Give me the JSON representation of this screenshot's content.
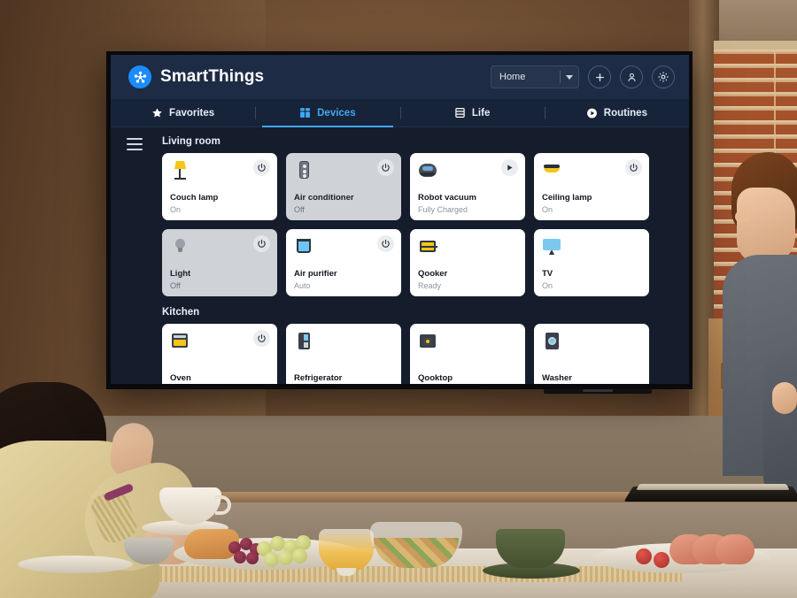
{
  "app": {
    "brand_name": "SmartThings",
    "logo_icon": "smartthings-logo-icon",
    "home_selector": {
      "value": "Home",
      "caret_icon": "chevron-down-icon"
    },
    "header_buttons": [
      {
        "name": "add-button",
        "icon": "plus-icon",
        "label": "+"
      },
      {
        "name": "account-button",
        "icon": "person-icon",
        "label": ""
      },
      {
        "name": "settings-button",
        "icon": "gear-icon",
        "label": ""
      }
    ],
    "menu_icon": "hamburger-menu-icon"
  },
  "tabs": [
    {
      "label": "Favorites",
      "icon": "star-icon",
      "active": false
    },
    {
      "label": "Devices",
      "icon": "grid-icon",
      "active": true
    },
    {
      "label": "Life",
      "icon": "book-icon",
      "active": false
    },
    {
      "label": "Routines",
      "icon": "play-circle-icon",
      "active": false
    }
  ],
  "rooms": [
    {
      "title": "Living room",
      "devices": [
        {
          "name": "Couch lamp",
          "status": "On",
          "icon": "floor-lamp-icon",
          "state": "on",
          "control": "power"
        },
        {
          "name": "Air conditioner",
          "status": "Off",
          "icon": "remote-control-icon",
          "state": "off",
          "control": "power"
        },
        {
          "name": "Robot vacuum",
          "status": "Fully Charged",
          "icon": "robot-vacuum-icon",
          "state": "on",
          "control": "play"
        },
        {
          "name": "Ceiling lamp",
          "status": "On",
          "icon": "ceiling-lamp-icon",
          "state": "on",
          "control": "power"
        },
        {
          "name": "Light",
          "status": "Off",
          "icon": "light-bulb-icon",
          "state": "off",
          "control": "power"
        },
        {
          "name": "Air purifier",
          "status": "Auto",
          "icon": "air-purifier-icon",
          "state": "on",
          "control": "power"
        },
        {
          "name": "Qooker",
          "status": "Ready",
          "icon": "qooker-tap-icon",
          "state": "on",
          "control": "none"
        },
        {
          "name": "TV",
          "status": "On",
          "icon": "television-icon",
          "state": "on",
          "control": "none"
        }
      ]
    },
    {
      "title": "Kitchen",
      "devices": [
        {
          "name": "Oven",
          "status": "",
          "icon": "oven-icon",
          "state": "on",
          "control": "power"
        },
        {
          "name": "Refrigerator",
          "status": "",
          "icon": "refrigerator-icon",
          "state": "on",
          "control": "none"
        },
        {
          "name": "Qooktop",
          "status": "",
          "icon": "cooktop-icon",
          "state": "on",
          "control": "none"
        },
        {
          "name": "Washer",
          "status": "",
          "icon": "washer-icon",
          "state": "on",
          "control": "none"
        }
      ]
    }
  ],
  "colors": {
    "brand_blue": "#1a8cff",
    "accent_blue": "#3fa9f5",
    "header_navy": "#1d2b45",
    "tabbar_navy": "#172339",
    "content_navy": "#151c2b",
    "card_on": "#ffffff",
    "card_off": "#cfd2d6",
    "icon_yellow": "#f5c518"
  }
}
